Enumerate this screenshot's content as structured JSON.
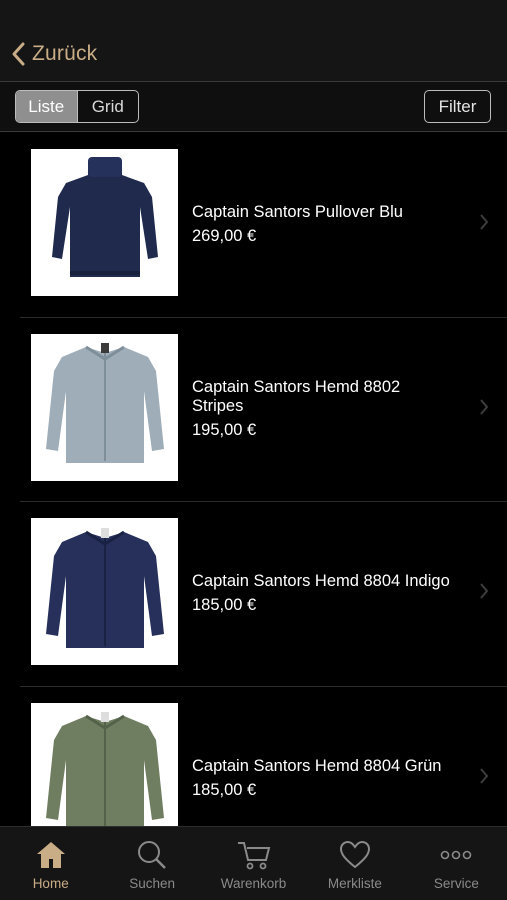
{
  "nav": {
    "back_label": "Zurück"
  },
  "toolbar": {
    "segments": [
      "Liste",
      "Grid"
    ],
    "active_segment": "Liste",
    "filter_label": "Filter"
  },
  "products": [
    {
      "name": "Captain Santors Pullover Blu",
      "price": "269,00 €",
      "image": "navy-turtleneck-sweater"
    },
    {
      "name": "Captain Santors Hemd 8802 Stripes",
      "price": "195,00 €",
      "image": "light-blue-striped-shirt"
    },
    {
      "name": "Captain Santors Hemd 8804 Indigo",
      "price": "185,00 €",
      "image": "indigo-shirt"
    },
    {
      "name": "Captain Santors Hemd 8804 Grün",
      "price": "185,00 €",
      "image": "green-shirt"
    }
  ],
  "tabs": [
    {
      "label": "Home",
      "icon": "home-icon",
      "active": true
    },
    {
      "label": "Suchen",
      "icon": "search-icon",
      "active": false
    },
    {
      "label": "Warenkorb",
      "icon": "cart-icon",
      "active": false
    },
    {
      "label": "Merkliste",
      "icon": "heart-icon",
      "active": false
    },
    {
      "label": "Service",
      "icon": "more-dots-icon",
      "active": false
    }
  ],
  "colors": {
    "accent": "#c9ad86",
    "background": "#000000",
    "inactive_tab": "#8a8a8a"
  }
}
